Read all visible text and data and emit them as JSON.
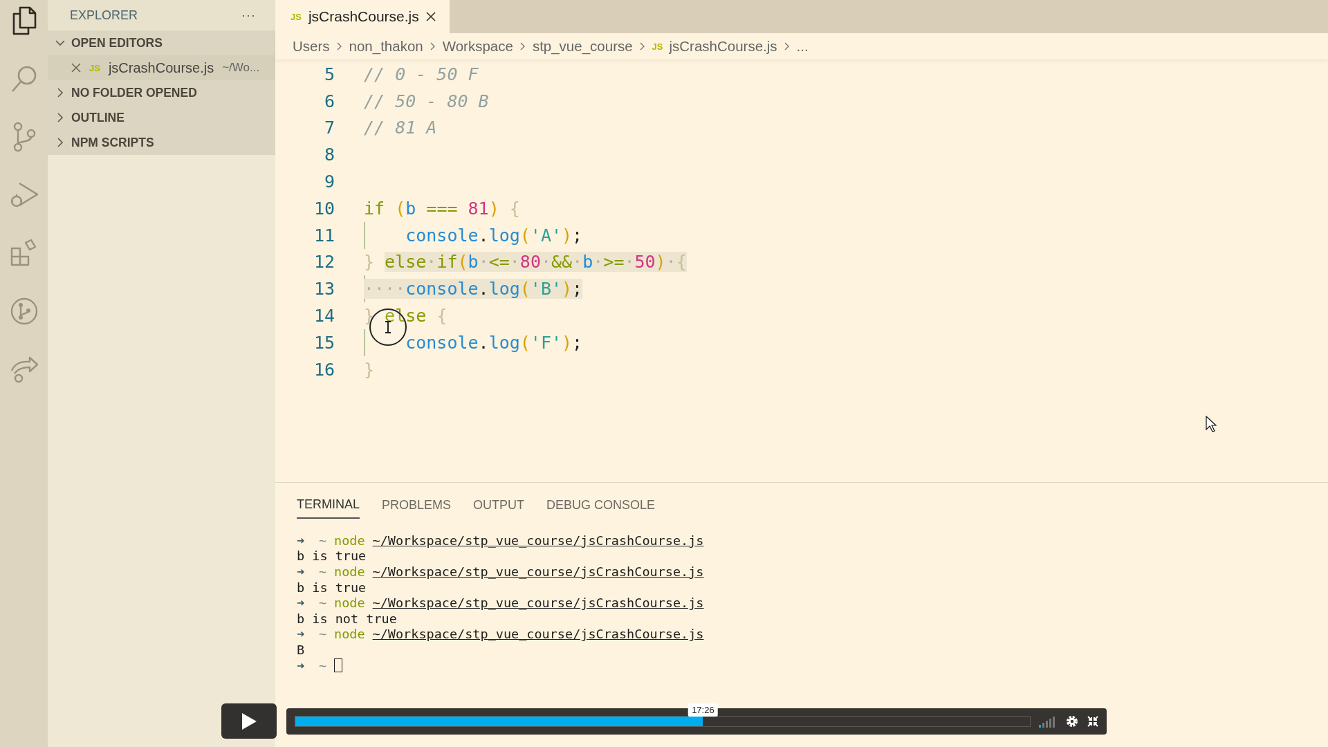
{
  "activity_bar": {
    "items": [
      {
        "kind": "files",
        "selected": true
      },
      {
        "kind": "search",
        "selected": false
      },
      {
        "kind": "source-control",
        "selected": false
      },
      {
        "kind": "run-debug",
        "selected": false
      },
      {
        "kind": "extensions",
        "selected": false
      },
      {
        "kind": "git-graph",
        "selected": false
      },
      {
        "kind": "live-share",
        "selected": false
      }
    ]
  },
  "sidebar": {
    "title": "EXPLORER",
    "more": "···",
    "sections": [
      {
        "label": "OPEN EDITORS",
        "expanded": true,
        "items": [
          {
            "badge": "JS",
            "name": "jsCrashCourse.js",
            "path": "~/Wo...",
            "selected": true
          }
        ]
      },
      {
        "label": "NO FOLDER OPENED",
        "expanded": false
      },
      {
        "label": "OUTLINE",
        "expanded": false
      },
      {
        "label": "NPM SCRIPTS",
        "expanded": false
      }
    ]
  },
  "editor": {
    "tabs": [
      {
        "badge": "JS",
        "label": "jsCrashCourse.js",
        "selected": true
      }
    ],
    "breadcrumbs": [
      {
        "text": "Users"
      },
      {
        "text": "non_thakon"
      },
      {
        "text": "Workspace"
      },
      {
        "text": "stp_vue_course"
      },
      {
        "text": "jsCrashCourse.js",
        "badge": "JS"
      },
      {
        "text": "..."
      }
    ],
    "lines": [
      {
        "number": "5",
        "indent_guide": false,
        "tokens": [
          {
            "text": "// 0 - 50 F",
            "kind": "comment",
            "selected": false
          }
        ]
      },
      {
        "number": "6",
        "indent_guide": false,
        "tokens": [
          {
            "text": "// 50 - 80 B",
            "kind": "comment",
            "selected": false
          }
        ]
      },
      {
        "number": "7",
        "indent_guide": false,
        "tokens": [
          {
            "text": "// 81 A",
            "kind": "comment",
            "selected": false
          }
        ]
      },
      {
        "number": "8"
      },
      {
        "number": "9"
      },
      {
        "number": "10",
        "indent_guide": false,
        "tokens": [
          {
            "text": "if",
            "kind": "keyword",
            "selected": false
          },
          {
            "text": " (",
            "kind": "paren",
            "selected": false
          },
          {
            "text": "b",
            "kind": "ident",
            "selected": false
          },
          {
            "text": " ===",
            "kind": "op",
            "selected": false
          },
          {
            "text": " 81",
            "kind": "number",
            "selected": false
          },
          {
            "text": ")",
            "kind": "paren",
            "selected": false
          },
          {
            "text": " {",
            "kind": "brace",
            "selected": false
          }
        ]
      },
      {
        "number": "11",
        "indent_guide": true,
        "tokens": [
          {
            "text": "console",
            "kind": "ident",
            "selected": false
          },
          {
            "text": ".",
            "kind": "punct",
            "selected": false
          },
          {
            "text": "log",
            "kind": "ident",
            "selected": false
          },
          {
            "text": "(",
            "kind": "paren",
            "selected": false
          },
          {
            "text": "'A'",
            "kind": "string",
            "selected": false
          },
          {
            "text": ")",
            "kind": "paren",
            "selected": false
          },
          {
            "text": ";",
            "kind": "punct",
            "selected": false
          }
        ]
      },
      {
        "number": "12",
        "indent_guide": false,
        "tokens": [
          {
            "text": "} ",
            "kind": "brace",
            "selected": false
          },
          {
            "text": "else",
            "kind": "keyword",
            "selected": true
          },
          {
            "text": "·",
            "kind": "whitespace",
            "selected": true
          },
          {
            "text": "if",
            "kind": "keyword",
            "selected": true
          },
          {
            "text": "(",
            "kind": "paren",
            "selected": true
          },
          {
            "text": "b",
            "kind": "ident",
            "selected": true
          },
          {
            "text": "·",
            "kind": "whitespace",
            "selected": true
          },
          {
            "text": "<=",
            "kind": "op",
            "selected": true
          },
          {
            "text": "·",
            "kind": "whitespace",
            "selected": true
          },
          {
            "text": "80",
            "kind": "number",
            "selected": true
          },
          {
            "text": "·",
            "kind": "whitespace",
            "selected": true
          },
          {
            "text": "&&",
            "kind": "op",
            "selected": true
          },
          {
            "text": "·",
            "kind": "whitespace",
            "selected": true
          },
          {
            "text": "b",
            "kind": "ident",
            "selected": true
          },
          {
            "text": "·",
            "kind": "whitespace",
            "selected": true
          },
          {
            "text": ">=",
            "kind": "op",
            "selected": true
          },
          {
            "text": "·",
            "kind": "whitespace",
            "selected": true
          },
          {
            "text": "50",
            "kind": "number",
            "selected": true
          },
          {
            "text": ")",
            "kind": "paren",
            "selected": true
          },
          {
            "text": "·",
            "kind": "whitespace",
            "selected": true
          },
          {
            "text": "{",
            "kind": "brace",
            "selected": true
          }
        ]
      },
      {
        "number": "13",
        "indent_guide": true,
        "tokens": [
          {
            "text": "····",
            "kind": "whitespace",
            "selected": true
          },
          {
            "text": "console",
            "kind": "ident",
            "selected": true
          },
          {
            "text": ".",
            "kind": "punct",
            "selected": true
          },
          {
            "text": "log",
            "kind": "ident",
            "selected": true
          },
          {
            "text": "(",
            "kind": "paren",
            "selected": true
          },
          {
            "text": "'B'",
            "kind": "string",
            "selected": true
          },
          {
            "text": ")",
            "kind": "paren",
            "selected": true
          },
          {
            "text": ";",
            "kind": "punct",
            "selected": true
          }
        ]
      },
      {
        "number": "14",
        "indent_guide": false,
        "tokens": [
          {
            "text": "} ",
            "kind": "brace",
            "selected": false
          },
          {
            "text": "else",
            "kind": "keyword",
            "selected": false
          },
          {
            "text": " {",
            "kind": "brace",
            "selected": false
          }
        ]
      },
      {
        "number": "15",
        "indent_guide": true,
        "tokens": [
          {
            "text": "console",
            "kind": "ident",
            "selected": false
          },
          {
            "text": ".",
            "kind": "punct",
            "selected": false
          },
          {
            "text": "log",
            "kind": "ident",
            "selected": false
          },
          {
            "text": "(",
            "kind": "paren",
            "selected": false
          },
          {
            "text": "'F'",
            "kind": "string",
            "selected": false
          },
          {
            "text": ")",
            "kind": "paren",
            "selected": false
          },
          {
            "text": ";",
            "kind": "punct",
            "selected": false
          }
        ]
      },
      {
        "number": "16",
        "indent_guide": false,
        "tokens": [
          {
            "text": "}",
            "kind": "brace",
            "selected": false
          }
        ]
      }
    ]
  },
  "panel": {
    "tabs": [
      {
        "label": "TERMINAL",
        "selected": true
      },
      {
        "label": "PROBLEMS",
        "selected": false
      },
      {
        "label": "OUTPUT",
        "selected": false
      },
      {
        "label": "DEBUG CONSOLE",
        "selected": false
      }
    ],
    "terminal": [
      {
        "kind": "prompt",
        "arrow": "➜",
        "cwd": "~",
        "command": "node",
        "path": "~/Workspace/stp_vue_course/jsCrashCourse.js",
        "cursor": false
      },
      {
        "kind": "output",
        "text": "b is true"
      },
      {
        "kind": "prompt",
        "arrow": "➜",
        "cwd": "~",
        "command": "node",
        "path": "~/Workspace/stp_vue_course/jsCrashCourse.js",
        "cursor": false
      },
      {
        "kind": "output",
        "text": "b is true"
      },
      {
        "kind": "prompt",
        "arrow": "➜",
        "cwd": "~",
        "command": "node",
        "path": "~/Workspace/stp_vue_course/jsCrashCourse.js",
        "cursor": false
      },
      {
        "kind": "output",
        "text": "b is not true"
      },
      {
        "kind": "prompt",
        "arrow": "➜",
        "cwd": "~",
        "command": "node",
        "path": "~/Workspace/stp_vue_course/jsCrashCourse.js",
        "cursor": false
      },
      {
        "kind": "output",
        "text": "B"
      },
      {
        "kind": "prompt",
        "arrow": "➜",
        "cwd": "~",
        "cursor": true
      }
    ]
  },
  "video_player": {
    "time_tooltip": "17:26",
    "level": 0.555,
    "volume": {
      "level": 0.2
    }
  }
}
